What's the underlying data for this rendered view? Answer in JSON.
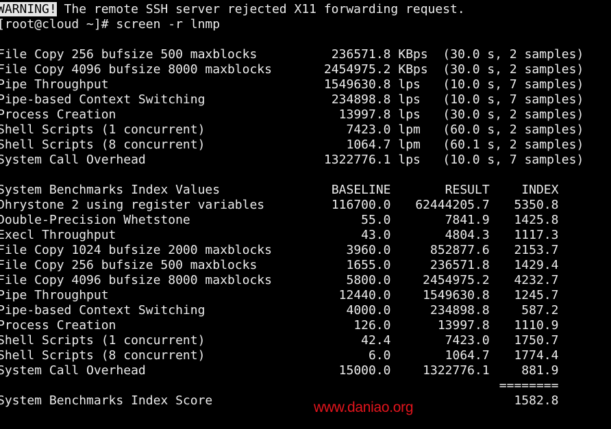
{
  "terminal": {
    "warning_badge": "WARNING!",
    "warning_text": " The remote SSH server rejected X11 forwarding request.",
    "prompt": "[root@cloud ~]# screen -r lnmp"
  },
  "results": [
    {
      "label": "File Copy 256 bufsize 500 maxblocks",
      "value": "236571.8",
      "unit": "KBps",
      "detail": "(30.0 s, 2 samples)"
    },
    {
      "label": "File Copy 4096 bufsize 8000 maxblocks",
      "value": "2454975.2",
      "unit": "KBps",
      "detail": "(30.0 s, 2 samples)"
    },
    {
      "label": "Pipe Throughput",
      "value": "1549630.8",
      "unit": "lps",
      "detail": "(10.0 s, 7 samples)"
    },
    {
      "label": "Pipe-based Context Switching",
      "value": "234898.8",
      "unit": "lps",
      "detail": "(10.0 s, 7 samples)"
    },
    {
      "label": "Process Creation",
      "value": "13997.8",
      "unit": "lps",
      "detail": "(30.0 s, 2 samples)"
    },
    {
      "label": "Shell Scripts (1 concurrent)",
      "value": "7423.0",
      "unit": "lpm",
      "detail": "(60.0 s, 2 samples)"
    },
    {
      "label": "Shell Scripts (8 concurrent)",
      "value": "1064.7",
      "unit": "lpm",
      "detail": "(60.1 s, 2 samples)"
    },
    {
      "label": "System Call Overhead",
      "value": "1322776.1",
      "unit": "lps",
      "detail": "(10.0 s, 7 samples)"
    }
  ],
  "index_table": {
    "title": "System Benchmarks Index Values",
    "headers": [
      "BASELINE",
      "RESULT",
      "INDEX"
    ],
    "rows": [
      {
        "label": "Dhrystone 2 using register variables",
        "baseline": "116700.0",
        "result": "62444205.7",
        "index": "5350.8"
      },
      {
        "label": "Double-Precision Whetstone",
        "baseline": "55.0",
        "result": "7841.9",
        "index": "1425.8"
      },
      {
        "label": "Execl Throughput",
        "baseline": "43.0",
        "result": "4804.3",
        "index": "1117.3"
      },
      {
        "label": "File Copy 1024 bufsize 2000 maxblocks",
        "baseline": "3960.0",
        "result": "852877.6",
        "index": "2153.7"
      },
      {
        "label": "File Copy 256 bufsize 500 maxblocks",
        "baseline": "1655.0",
        "result": "236571.8",
        "index": "1429.4"
      },
      {
        "label": "File Copy 4096 bufsize 8000 maxblocks",
        "baseline": "5800.0",
        "result": "2454975.2",
        "index": "4232.7"
      },
      {
        "label": "Pipe Throughput",
        "baseline": "12440.0",
        "result": "1549630.8",
        "index": "1245.7"
      },
      {
        "label": "Pipe-based Context Switching",
        "baseline": "4000.0",
        "result": "234898.8",
        "index": "587.2"
      },
      {
        "label": "Process Creation",
        "baseline": "126.0",
        "result": "13997.8",
        "index": "1110.9"
      },
      {
        "label": "Shell Scripts (1 concurrent)",
        "baseline": "42.4",
        "result": "7423.0",
        "index": "1750.7"
      },
      {
        "label": "Shell Scripts (8 concurrent)",
        "baseline": "6.0",
        "result": "1064.7",
        "index": "1774.4"
      },
      {
        "label": "System Call Overhead",
        "baseline": "15000.0",
        "result": "1322776.1",
        "index": "881.9"
      }
    ],
    "separator": "========",
    "score_label": "System Benchmarks Index Score",
    "score": "1582.8"
  },
  "watermark": "www.daniao.org"
}
